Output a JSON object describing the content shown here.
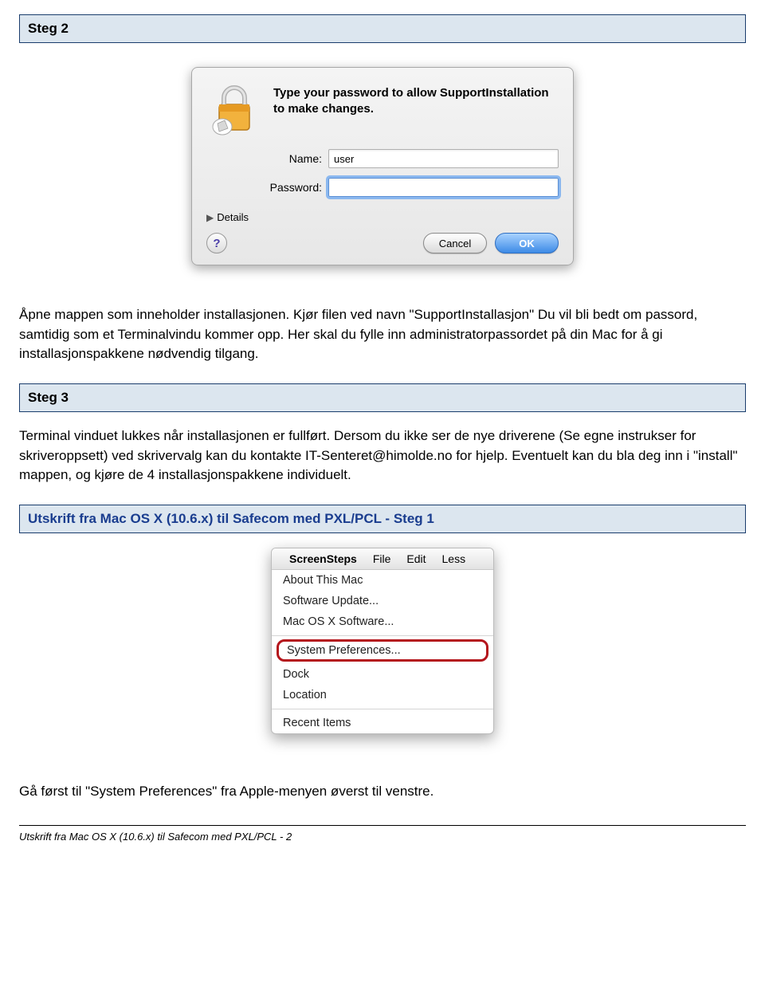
{
  "steg2": {
    "header": "Steg 2",
    "dialog": {
      "title": "Type your password to allow SupportInstallation to make changes.",
      "name_label": "Name:",
      "name_value": "user",
      "password_label": "Password:",
      "password_value": "",
      "details_label": "Details",
      "help_symbol": "?",
      "cancel_label": "Cancel",
      "ok_label": "OK"
    },
    "body": "Åpne mappen som inneholder installasjonen. Kjør filen ved navn \"SupportInstallasjon\" Du vil bli bedt om passord, samtidig som et Terminalvindu kommer opp. Her skal du fylle inn administratorpassordet på din Mac for å gi installasjonspakkene nødvendig tilgang."
  },
  "steg3": {
    "header": "Steg 3",
    "body": "Terminal vinduet lukkes når installasjonen er fullført. Dersom du ikke ser de nye driverene (Se egne instrukser for skriveroppsett) ved skrivervalg kan du kontakte IT-Senteret@himolde.no for hjelp. Eventuelt kan du bla deg inn i \"install\" mappen, og kjøre de 4 installasjonspakkene individuelt."
  },
  "utskrift": {
    "header": "Utskrift fra Mac OS X (10.6.x) til Safecom med PXL/PCL - Steg 1",
    "menubar": {
      "apple": "",
      "app": "ScreenSteps",
      "items": [
        "File",
        "Edit",
        "Less"
      ]
    },
    "menu_items": [
      "About This Mac",
      "Software Update...",
      "Mac OS X Software...",
      "System Preferences...",
      "Dock",
      "Location",
      "Recent Items"
    ],
    "highlight_index": 3,
    "body": "Gå først til \"System Preferences\" fra Apple-menyen øverst til venstre."
  },
  "footer": "Utskrift fra Mac OS X (10.6.x) til Safecom med PXL/PCL - 2"
}
